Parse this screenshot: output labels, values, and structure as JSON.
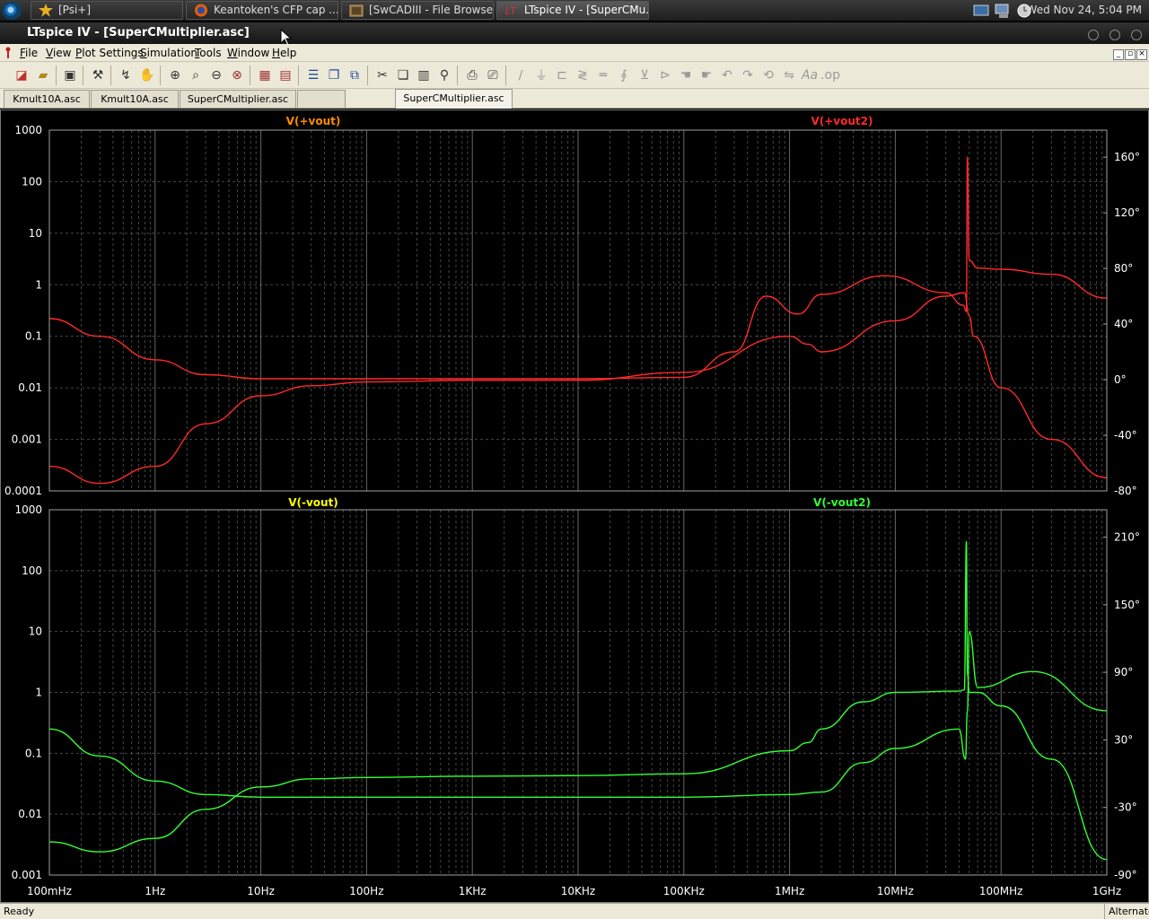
{
  "taskbar": {
    "tasks": [
      {
        "label": "[Psi+]",
        "icon": "star-icon"
      },
      {
        "label": "Keantoken's CFP cap ...",
        "icon": "firefox-icon"
      },
      {
        "label": "[SwCADIII - File Browser]",
        "icon": "folder-icon"
      },
      {
        "label": "LTspice IV - [SuperCMu...",
        "icon": "ltspice-icon"
      }
    ],
    "clock": "Wed Nov 24,  5:04 PM"
  },
  "window": {
    "title": "LTspice IV - [SuperCMultiplier.asc]"
  },
  "menu": [
    "File",
    "View",
    "Plot Settings",
    "Simulation",
    "Tools",
    "Window",
    "Help"
  ],
  "tabs": [
    {
      "label": "Kmult10A.asc",
      "active": false
    },
    {
      "label": "Kmult10A.asc",
      "active": false
    },
    {
      "label": "SuperCMultiplier.asc",
      "active": false
    },
    {
      "label": "",
      "active": false
    },
    {
      "label": "SuperCMultiplier.asc",
      "active": true
    }
  ],
  "status": {
    "left": "Ready",
    "right": "Alternate"
  },
  "colors": {
    "red": "#ff2a2a",
    "orange": "#ff8c00",
    "yellow": "#ffff00",
    "green": "#33ff33",
    "grid": "#808080",
    "axis_text": "#ffffff"
  },
  "chart_data": [
    {
      "type": "line",
      "legend": [
        "V(+vout)",
        "V(+vout2)"
      ],
      "x_scale": "log",
      "x_ticks": [
        "100mHz",
        "1Hz",
        "10Hz",
        "100Hz",
        "1KHz",
        "10KHz",
        "100KHz",
        "1MHz",
        "10MHz",
        "100MHz",
        "1GHz"
      ],
      "xlim_hz": [
        0.1,
        1000000000
      ],
      "y_scale": "log",
      "y_ticks": [
        "1000",
        "100",
        "10",
        "1",
        "0.1",
        "0.01",
        "0.001",
        "0.0001"
      ],
      "ylim": [
        0.0001,
        1000
      ],
      "y2_ticks": [
        "160°",
        "120°",
        "80°",
        "40°",
        "0°",
        "-40°",
        "-80°"
      ],
      "y2lim_deg": [
        -80,
        160
      ],
      "series": [
        {
          "name": "magnitude",
          "x_hz": [
            0.1,
            0.3,
            1,
            3,
            10,
            100,
            1000,
            10000,
            100000,
            300000,
            600000,
            1200000,
            2000000,
            8000000,
            30000000,
            44000000,
            47000000,
            48000000,
            50000000,
            60000000,
            100000000,
            300000000,
            1000000000
          ],
          "y": [
            0.22,
            0.1,
            0.035,
            0.018,
            0.015,
            0.015,
            0.015,
            0.015,
            0.016,
            0.05,
            0.6,
            0.27,
            0.65,
            1.5,
            0.7,
            0.4,
            0.3,
            300,
            3,
            2.1,
            2.0,
            1.6,
            0.55
          ]
        },
        {
          "name": "phase",
          "x_hz": [
            0.1,
            0.3,
            1,
            3,
            10,
            30,
            100,
            1000,
            10000,
            100000,
            1000000,
            1500000,
            2000000,
            10000000,
            30000000,
            45000000,
            50000000,
            55000000,
            100000000,
            300000000,
            1000000000
          ],
          "y": [
            0.0003,
            0.00014,
            0.0003,
            0.002,
            0.007,
            0.011,
            0.013,
            0.014,
            0.014,
            0.02,
            0.1,
            0.07,
            0.05,
            0.2,
            0.6,
            0.7,
            0.25,
            0.1,
            0.01,
            0.001,
            0.00018
          ]
        }
      ]
    },
    {
      "type": "line",
      "legend": [
        "V(-vout)",
        "V(-vout2)"
      ],
      "x_scale": "log",
      "x_ticks": [
        "100mHz",
        "1Hz",
        "10Hz",
        "100Hz",
        "1KHz",
        "10KHz",
        "100KHz",
        "1MHz",
        "10MHz",
        "100MHz",
        "1GHz"
      ],
      "xlim_hz": [
        0.1,
        1000000000
      ],
      "y_scale": "log",
      "y_ticks": [
        "1000",
        "100",
        "10",
        "1",
        "0.1",
        "0.01",
        "0.001"
      ],
      "ylim": [
        0.001,
        1000
      ],
      "y2_ticks": [
        "210°",
        "150°",
        "90°",
        "30°",
        "-30°",
        "-90°"
      ],
      "y2lim_deg": [
        -90,
        210
      ],
      "series": [
        {
          "name": "magnitude",
          "x_hz": [
            0.1,
            0.3,
            1,
            3,
            10,
            100,
            1000,
            10000,
            100000,
            1000000,
            2000000,
            5000000,
            10000000,
            40000000,
            46000000,
            48000000,
            50000000,
            60000000,
            200000000,
            1000000000
          ],
          "y": [
            0.25,
            0.09,
            0.035,
            0.021,
            0.019,
            0.019,
            0.019,
            0.019,
            0.019,
            0.021,
            0.023,
            0.07,
            0.12,
            0.25,
            0.08,
            0.5,
            10,
            1.2,
            2.2,
            0.5
          ]
        },
        {
          "name": "phase",
          "x_hz": [
            0.1,
            0.3,
            1,
            3,
            10,
            30,
            100,
            1000,
            10000,
            100000,
            1000000,
            1500000,
            2000000,
            5000000,
            10000000,
            40000000,
            45000000,
            47000000,
            48000000,
            50000000,
            60000000,
            100000000,
            300000000,
            1000000000
          ],
          "y": [
            0.0035,
            0.0024,
            0.004,
            0.012,
            0.028,
            0.038,
            0.04,
            0.042,
            0.043,
            0.046,
            0.11,
            0.15,
            0.25,
            0.7,
            1.0,
            1.05,
            1.1,
            300,
            2,
            1.0,
            1.0,
            0.6,
            0.08,
            0.0018
          ]
        }
      ]
    }
  ]
}
